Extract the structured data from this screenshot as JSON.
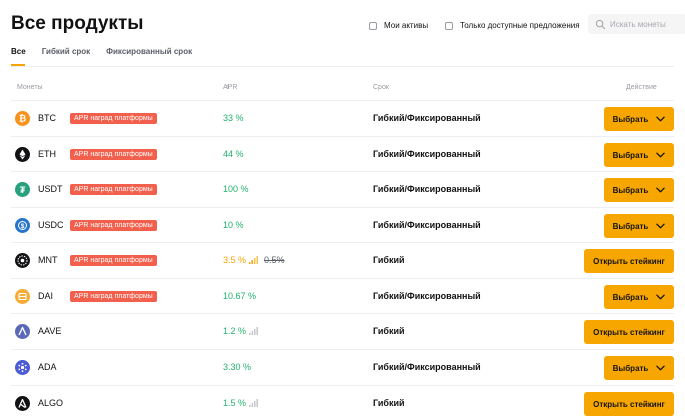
{
  "page": {
    "title": "Все продукты",
    "filters": {
      "my_assets": "Мои активы",
      "available_only": "Только доступные предложения"
    },
    "search": {
      "placeholder": "Искать монеты"
    },
    "tabs": [
      {
        "label": "Все"
      },
      {
        "label": "Гибкий срок"
      },
      {
        "label": "Фиксированный срок"
      }
    ],
    "table": {
      "headers": {
        "coins": "Монеты",
        "apr": "APR",
        "term": "Срок",
        "action": "Действие"
      },
      "rows": [
        {
          "coin": "BTC",
          "badge": "APR наград платформы",
          "apr": "33 %",
          "apr_old": "",
          "term": "Гибкий/Фиксированный",
          "action": "Выбрать",
          "icon": "btc-icon",
          "color": "#f7931a"
        },
        {
          "coin": "ETH",
          "badge": "APR наград платформы",
          "apr": "44 %",
          "apr_old": "",
          "term": "Гибкий/Фиксированный",
          "action": "Выбрать",
          "icon": "eth-icon",
          "color": "#121214"
        },
        {
          "coin": "USDT",
          "badge": "APR наград платформы",
          "apr": "100 %",
          "apr_old": "",
          "term": "Гибкий/Фиксированный",
          "action": "Выбрать",
          "icon": "usdt-icon",
          "color": "#26a17b"
        },
        {
          "coin": "USDC",
          "badge": "APR наград платформы",
          "apr": "10 %",
          "apr_old": "",
          "term": "Гибкий/Фиксированный",
          "action": "Выбрать",
          "icon": "usdc-icon",
          "color": "#2775ca"
        },
        {
          "coin": "MNT",
          "badge": "APR наград платформы",
          "apr": "3.5 %",
          "apr_old": "0.5%",
          "term": "Гибкий",
          "action": "Открыть стейкинг",
          "icon": "mnt-icon",
          "color": "#121214"
        },
        {
          "coin": "DAI",
          "badge": "APR наград платформы",
          "apr": "10.67 %",
          "apr_old": "",
          "term": "Гибкий/Фиксированный",
          "action": "Выбрать",
          "icon": "dai-icon",
          "color": "#f5ac37"
        },
        {
          "coin": "AAVE",
          "badge": "",
          "apr": "1.2 %",
          "apr_old": "",
          "term": "Гибкий",
          "action": "Открыть стейкинг",
          "icon": "aave-icon",
          "color": "#5b6ab8"
        },
        {
          "coin": "ADA",
          "badge": "",
          "apr": "3.30 %",
          "apr_old": "",
          "term": "Гибкий/Фиксированный",
          "action": "Выбрать",
          "icon": "ada-icon",
          "color": "#4a5bd4"
        },
        {
          "coin": "ALGO",
          "badge": "",
          "apr": "1.5 %",
          "apr_old": "",
          "term": "Гибкий",
          "action": "Открыть стейкинг",
          "icon": "algo-icon",
          "color": "#121214"
        }
      ]
    }
  },
  "colors": {
    "accent": "#f7a600",
    "positive": "#20b26c",
    "badge": "#f25f4c"
  }
}
